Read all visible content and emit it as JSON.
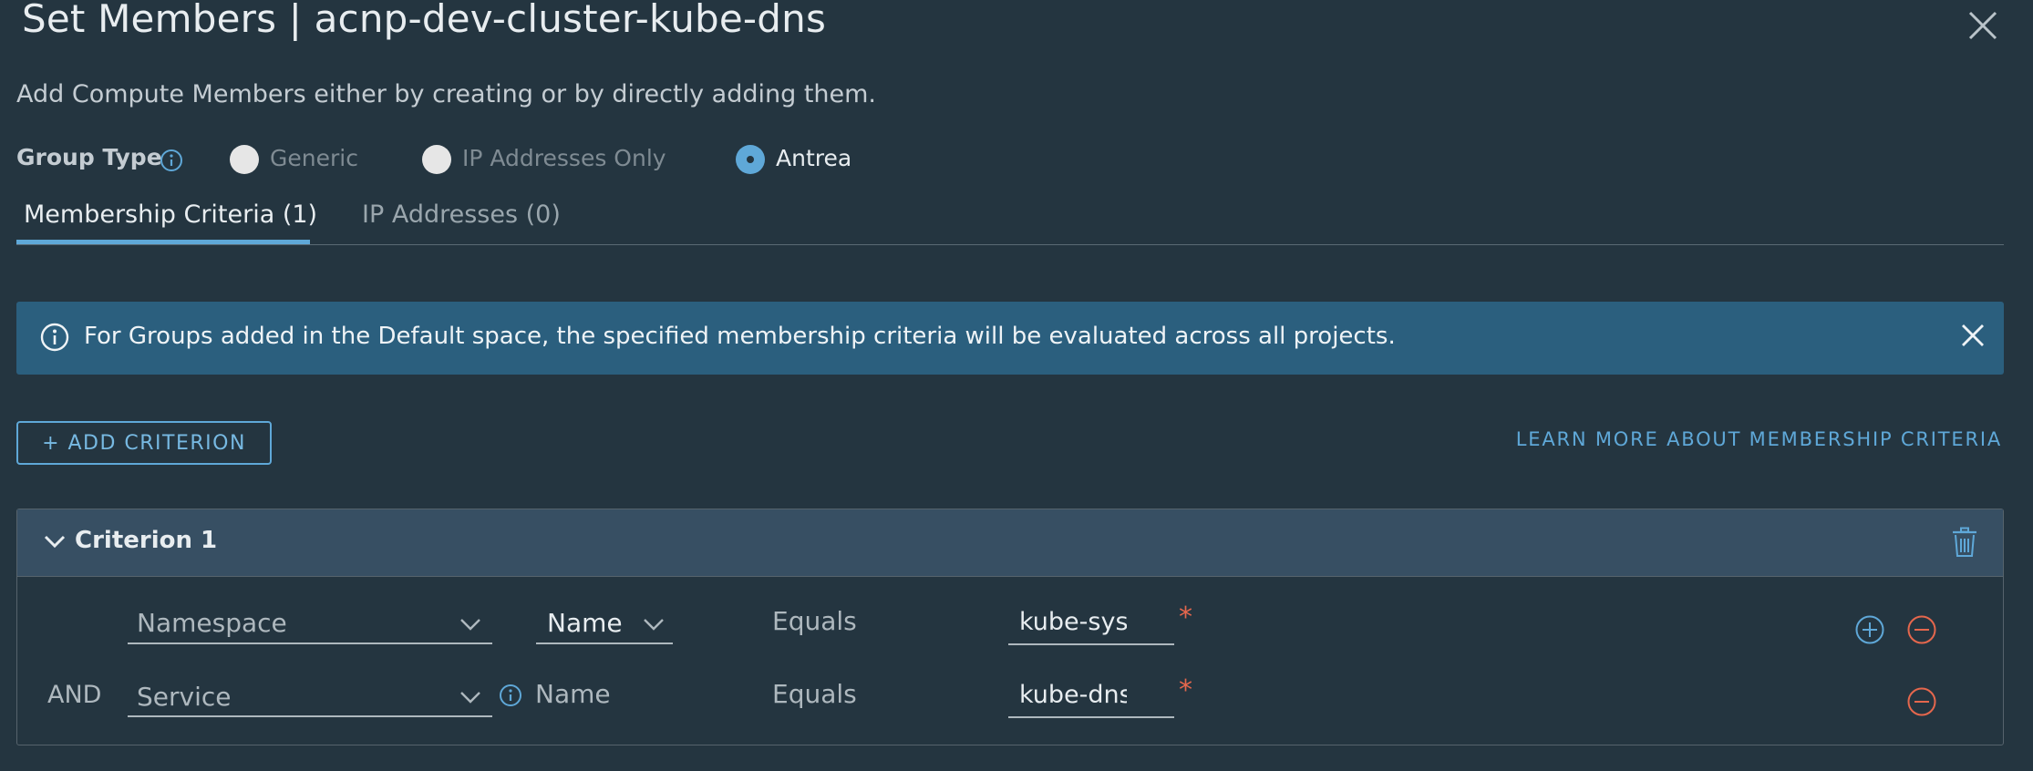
{
  "dialog": {
    "title": "Set Members | acnp-dev-cluster-kube-dns",
    "subtitle": "Add Compute Members either by creating or by directly adding them."
  },
  "group_type": {
    "label": "Group Type",
    "options": [
      {
        "label": "Generic",
        "selected": false,
        "disabled": true
      },
      {
        "label": "IP Addresses Only",
        "selected": false,
        "disabled": true
      },
      {
        "label": "Antrea",
        "selected": true,
        "disabled": false
      }
    ]
  },
  "tabs": [
    {
      "label": "Membership Criteria (1)",
      "active": true
    },
    {
      "label": "IP Addresses (0)",
      "active": false
    }
  ],
  "banner": {
    "text": "For Groups added in the Default space, the specified membership criteria will be evaluated across all projects."
  },
  "actions": {
    "add_criterion": "+ ADD CRITERION",
    "learn_more": "LEARN MORE ABOUT MEMBERSHIP CRITERIA"
  },
  "criterion": {
    "title": "Criterion 1",
    "rows": [
      {
        "conjunction": "",
        "member_type": "Namespace",
        "attribute": "Name",
        "operator": "Equals",
        "value": "kube-sys",
        "required_mark": "*"
      },
      {
        "conjunction": "AND",
        "member_type": "Service",
        "attribute": "Name",
        "operator": "Equals",
        "value": "kube-dns",
        "required_mark": "*"
      }
    ]
  },
  "colors": {
    "background": "#243540",
    "accent": "#5fa8d8",
    "banner": "#2b5f7e",
    "criterion_header": "#374f63",
    "danger": "#e5674d"
  }
}
